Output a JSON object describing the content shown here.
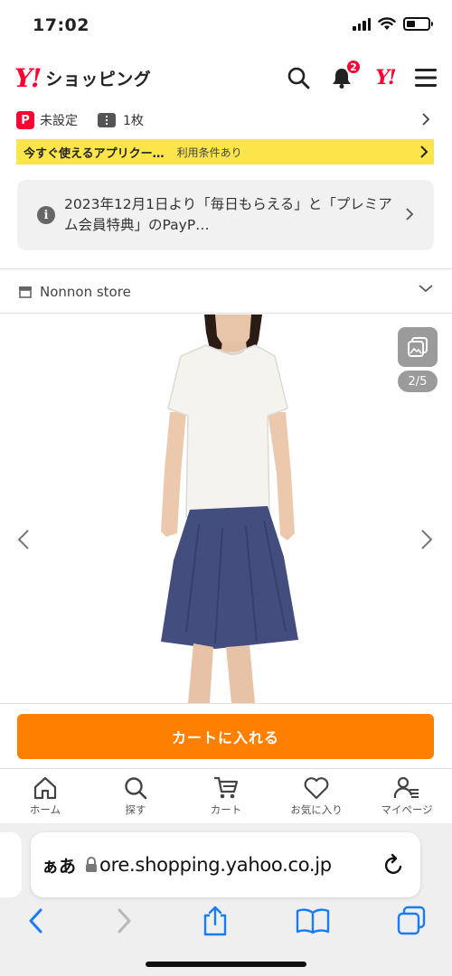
{
  "status_bar": {
    "time": "17:02"
  },
  "header": {
    "logo_y": "Y!",
    "logo_text": "ショッピング",
    "notification_count": "2",
    "yahoo_logo": "Y!"
  },
  "pay_row": {
    "paypay_icon": "P",
    "paypay_status": "未設定",
    "coupon_count": "1枚"
  },
  "banner": {
    "main_text": "今すぐ使えるアプリクー…",
    "sub_text": "利用条件あり"
  },
  "notice": {
    "text": "2023年12月1日より「毎日もらえる」と「プレミアム会員特典」のPayP…"
  },
  "store": {
    "name": "Nonnon store"
  },
  "gallery": {
    "counter": "2/5"
  },
  "cart_button": {
    "label": "カートに入れる"
  },
  "bottom_nav": [
    {
      "label": "ホーム",
      "icon": "home-icon"
    },
    {
      "label": "探す",
      "icon": "search-icon"
    },
    {
      "label": "カート",
      "icon": "cart-icon"
    },
    {
      "label": "お気に入り",
      "icon": "heart-icon"
    },
    {
      "label": "マイページ",
      "icon": "person-list-icon"
    }
  ],
  "safari": {
    "text_size_label": "ぁあ",
    "url": "ore.shopping.yahoo.co.jp"
  },
  "colors": {
    "brand_red": "#ff0033",
    "cart_orange": "#ff8000",
    "banner_yellow": "#fbe54a",
    "safari_blue": "#1a7cf5"
  }
}
